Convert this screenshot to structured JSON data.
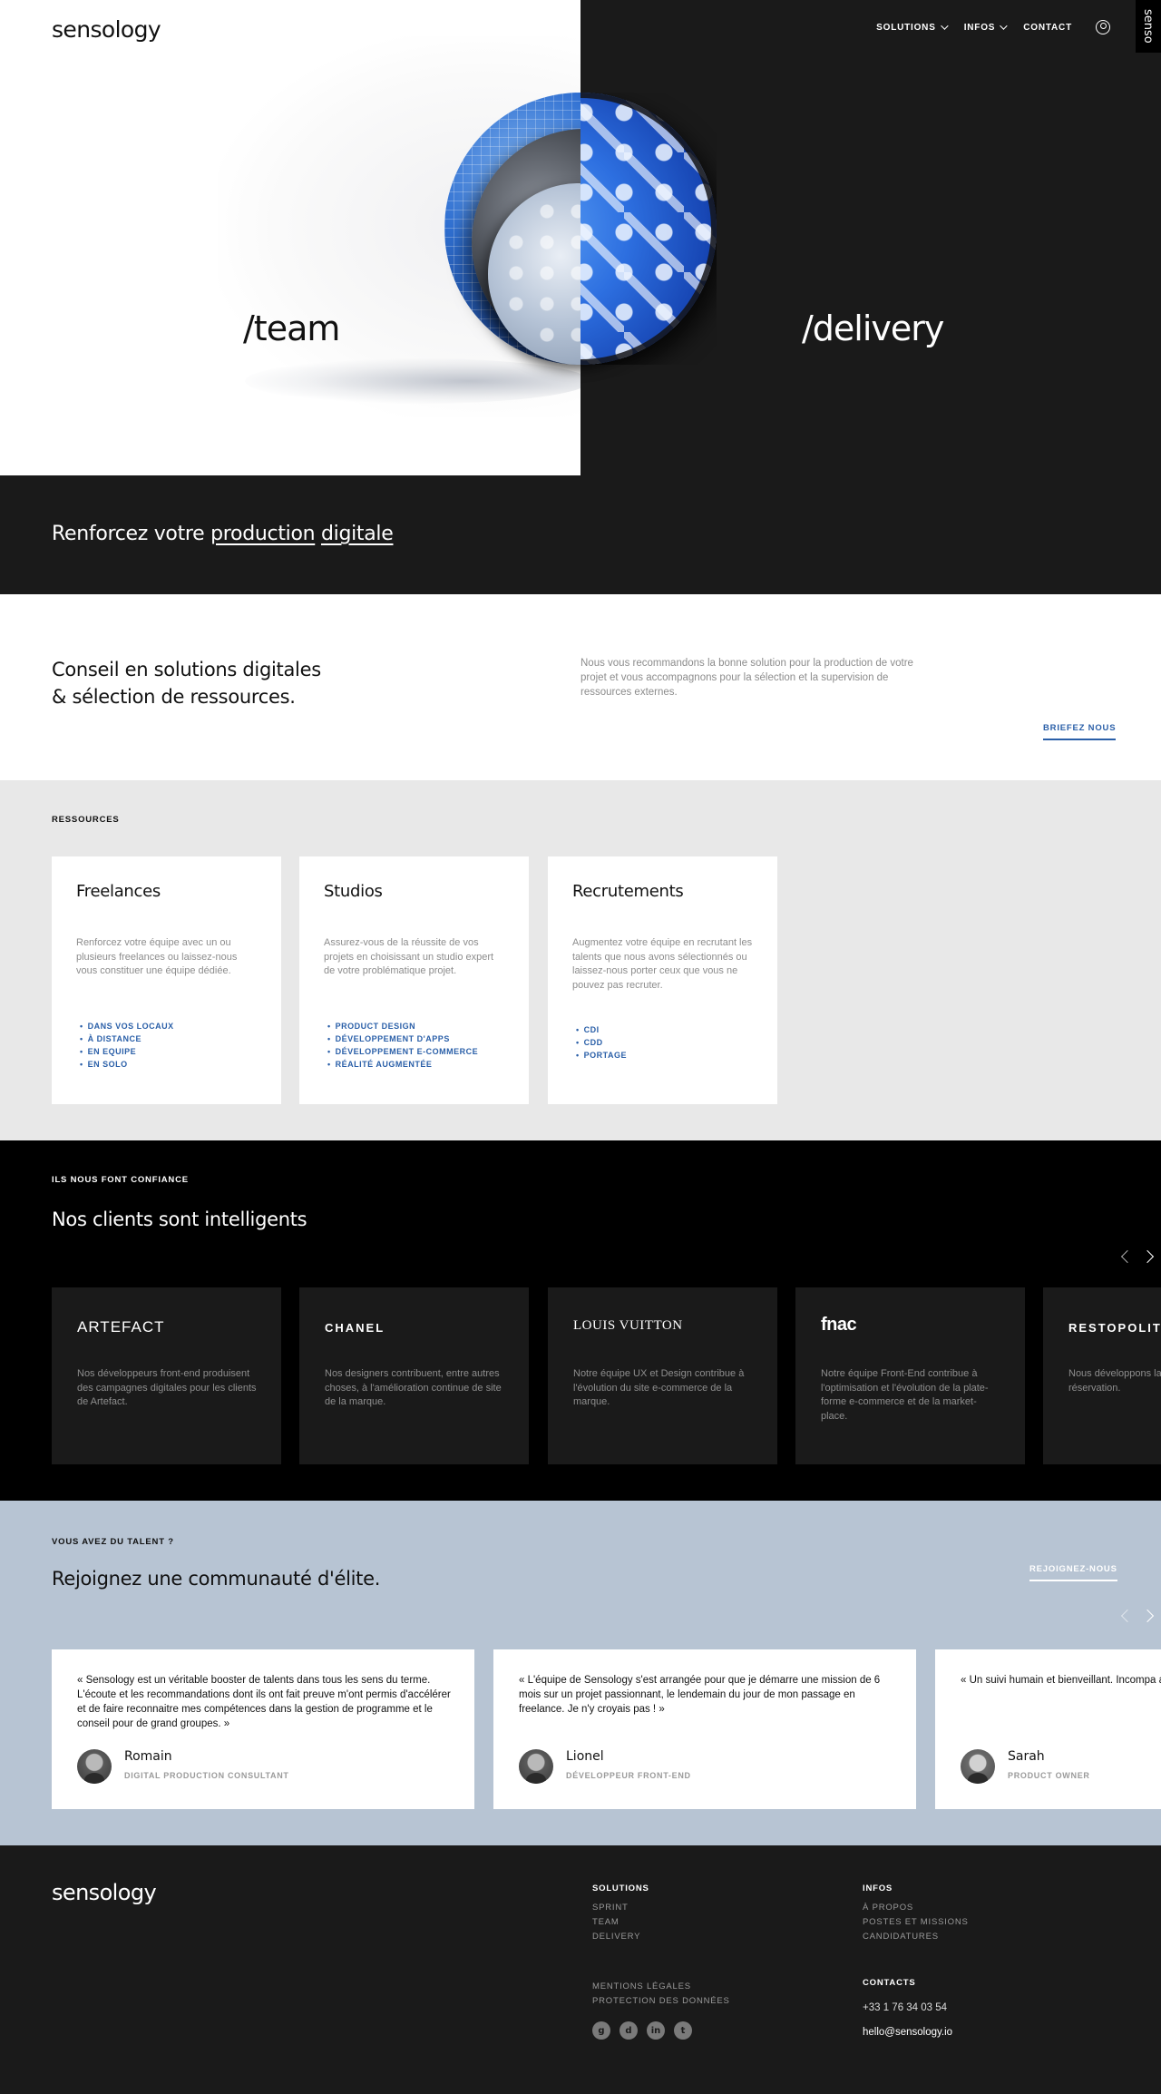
{
  "header": {
    "logo": "sensology",
    "nav": {
      "solutions": "SOLUTIONS",
      "infos": "INFOS",
      "contact": "CONTACT"
    },
    "side_tab": "senso"
  },
  "hero": {
    "left_word": "/team",
    "right_word": "/delivery"
  },
  "banner": {
    "prefix": "Renforcez votre",
    "link1": "production",
    "link2": "digitale"
  },
  "conseil": {
    "title_line1": "Conseil en solutions digitales",
    "title_line2": "& sélection de ressources.",
    "description": "Nous vous recommandons la bonne solution pour la production de votre projet et vous accompagnons pour la sélection et la supervision de ressources externes.",
    "cta": "BRIEFEZ NOUS"
  },
  "ressources": {
    "label": "RESSOURCES",
    "cards": [
      {
        "title": "Freelances",
        "text": "Renforcez votre équipe avec un ou plusieurs freelances ou laissez-nous vous constituer une équipe dédiée.",
        "items": [
          "DANS VOS LOCAUX",
          "À DISTANCE",
          "EN EQUIPE",
          "EN SOLO"
        ]
      },
      {
        "title": "Studios",
        "text": "Assurez-vous de la réussite de vos projets en choisissant un studio expert de votre problématique projet.",
        "items": [
          "PRODUCT DESIGN",
          "DÉVELOPPEMENT D'APPS",
          "DÉVELOPPEMENT E-COMMERCE",
          "RÉALITÉ AUGMENTÉE"
        ]
      },
      {
        "title": "Recrutements",
        "text": "Augmentez votre équipe en recrutant les talents que nous avons sélectionnés ou laissez-nous porter ceux que vous ne pouvez pas recruter.",
        "items": [
          "CDI",
          "CDD",
          "PORTAGE"
        ]
      }
    ]
  },
  "clients": {
    "label": "ILS NOUS FONT CONFIANCE",
    "title": "Nos clients sont intelligents",
    "cards": [
      {
        "logo": "ARTEFACT",
        "text": "Nos développeurs front-end produisent des campagnes digitales pour les clients de Artefact."
      },
      {
        "logo": "CHANEL",
        "text": "Nos designers contribuent, entre autres choses, à l'amélioration continue de site de la marque."
      },
      {
        "logo": "LOUIS VUITTON",
        "text": "Notre équipe UX et Design contribue à l'évolution du site e-commerce de la marque."
      },
      {
        "logo": "fnac",
        "text": "Notre équipe Front-End contribue à l'optimisation et l'évolution de la plate-forme e-commerce et de la market-place."
      },
      {
        "logo": "RESTOPOLITAN",
        "text": "Nous développons la version mobile de l réservation."
      }
    ]
  },
  "community": {
    "label": "VOUS AVEZ DU TALENT ?",
    "title": "Rejoignez une communauté d'élite.",
    "cta": "REJOIGNEZ-NOUS",
    "testimonials": [
      {
        "quote": "« Sensology est un véritable booster de talents dans tous les sens du terme. L'écoute et les recommandations dont ils ont fait preuve m'ont permis d'accélérer et de faire reconnaitre mes compétences dans la gestion de programme et le conseil pour de grand groupes. »",
        "name": "Romain",
        "role": "DIGITAL PRODUCTION CONSULTANT"
      },
      {
        "quote": "« L'équipe de Sensology s'est arrangée pour que je démarre une mission de 6 mois sur un projet passionnant, le lendemain du jour de mon passage en freelance. Je n'y croyais pas ! »",
        "name": "Lionel",
        "role": "DÉVELOPPEUR FRONT-END"
      },
      {
        "quote": "« Un suivi humain et bienveillant. Incompa ailleurs. »",
        "name": "Sarah",
        "role": "PRODUCT OWNER"
      }
    ]
  },
  "footer": {
    "logo": "sensology",
    "solutions": {
      "head": "SOLUTIONS",
      "links": [
        "SPRINT",
        "TEAM",
        "DELIVERY"
      ]
    },
    "infos": {
      "head": "INFOS",
      "links": [
        "À PROPOS",
        "POSTES ET MISSIONS",
        "CANDIDATURES"
      ]
    },
    "legal": [
      "MENTIONS LÉGALES",
      "PROTECTION DES DONNÉES"
    ],
    "contacts": {
      "head": "CONTACTS",
      "phone": "+33 1 76 34 03 54",
      "email": "hello@sensology.io"
    },
    "socials": [
      {
        "icon": "github-icon",
        "glyph": "g"
      },
      {
        "icon": "dribbble-icon",
        "glyph": "d"
      },
      {
        "icon": "linkedin-icon",
        "glyph": "in"
      },
      {
        "icon": "twitter-icon",
        "glyph": "t"
      }
    ]
  }
}
